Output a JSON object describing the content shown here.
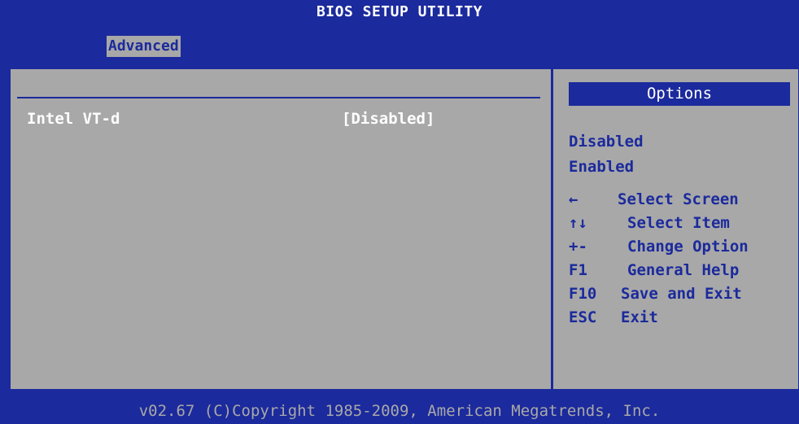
{
  "app": {
    "title": "BIOS SETUP UTILITY"
  },
  "tabs": [
    {
      "label": "Advanced",
      "active": true
    }
  ],
  "settings": [
    {
      "label": "Intel VT-d",
      "value": "[Disabled]"
    }
  ],
  "options_panel": {
    "header": "Options",
    "items": [
      "Disabled",
      "Enabled"
    ]
  },
  "help": [
    {
      "key": "←",
      "desc": "Select Screen",
      "icon": "left-arrow-icon"
    },
    {
      "key": "↑↓",
      "desc": "Select Item",
      "icon": "up-down-arrows-icon"
    },
    {
      "key": "+-",
      "desc": "Change Option"
    },
    {
      "key": "F1",
      "desc": "General Help"
    },
    {
      "key": "F10",
      "desc": "Save and Exit"
    },
    {
      "key": "ESC",
      "desc": "Exit"
    }
  ],
  "footer": {
    "text": "v02.67 (C)Copyright 1985-2009, American Megatrends, Inc."
  },
  "colors": {
    "bios_blue": "#1b2a9c",
    "panel_gray": "#a8a8a8",
    "text_white": "#ffffff"
  }
}
